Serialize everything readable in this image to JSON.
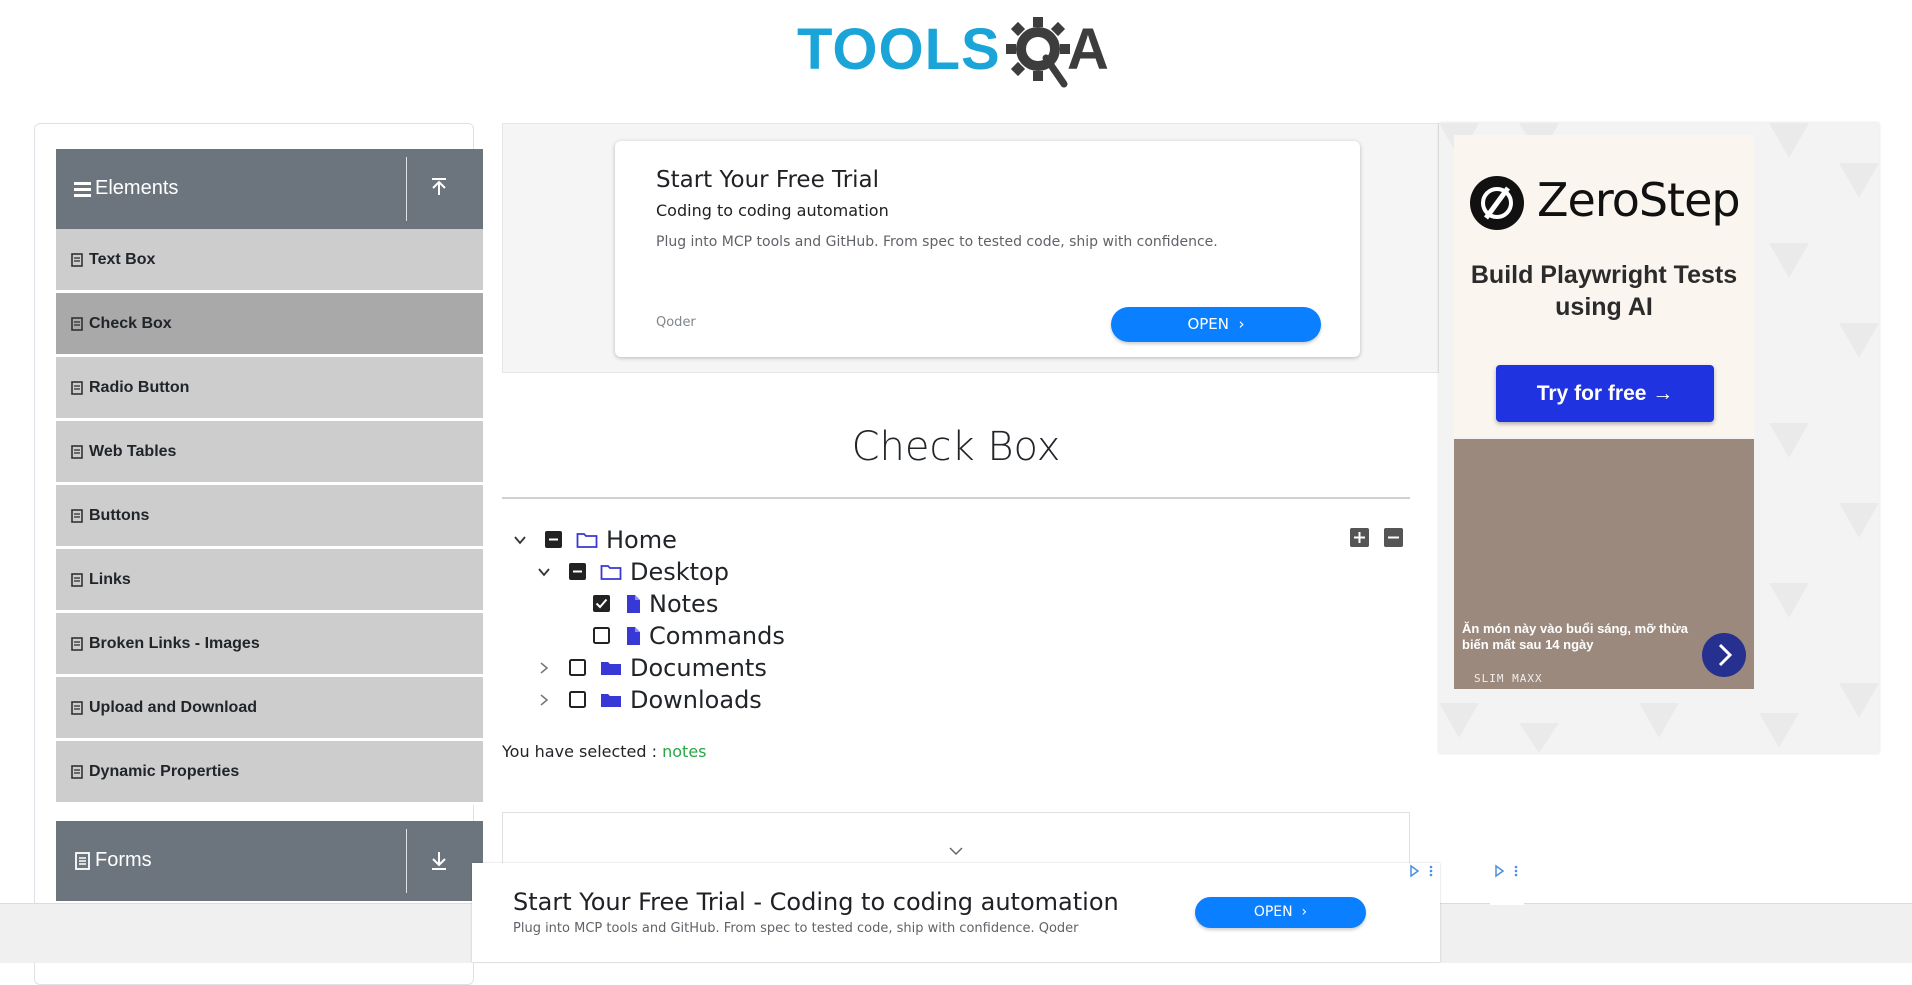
{
  "header": {
    "logo_tools": "TOOLS",
    "logo_a": "A"
  },
  "sidebar": {
    "group_elements": "Elements",
    "items": [
      {
        "label": "Text Box",
        "active": false
      },
      {
        "label": "Check Box",
        "active": true
      },
      {
        "label": "Radio Button",
        "active": false
      },
      {
        "label": "Web Tables",
        "active": false
      },
      {
        "label": "Buttons",
        "active": false
      },
      {
        "label": "Links",
        "active": false
      },
      {
        "label": "Broken Links - Images",
        "active": false
      },
      {
        "label": "Upload and Download",
        "active": false
      },
      {
        "label": "Dynamic Properties",
        "active": false
      }
    ],
    "group_forms": "Forms"
  },
  "top_ad": {
    "title": "Start Your Free Trial",
    "subtitle": "Coding to coding automation",
    "description": "Plug into MCP tools and GitHub. From spec to tested code, ship with confidence.",
    "brand": "Qoder",
    "button": "OPEN"
  },
  "main": {
    "title": "Check Box",
    "tree": [
      {
        "label": "Home",
        "state": "partial",
        "expanded": true,
        "type": "folder"
      },
      {
        "label": "Desktop",
        "state": "partial",
        "expanded": true,
        "type": "folder"
      },
      {
        "label": "Notes",
        "state": "checked",
        "type": "file"
      },
      {
        "label": "Commands",
        "state": "unchecked",
        "type": "file"
      },
      {
        "label": "Documents",
        "state": "unchecked",
        "expanded": false,
        "type": "folder"
      },
      {
        "label": "Downloads",
        "state": "unchecked",
        "expanded": false,
        "type": "folder"
      }
    ],
    "result_label": "You have selected :",
    "result_value": "notes"
  },
  "right_ad": {
    "brand": "ZeroStep",
    "headline": "Build Playwright Tests using AI",
    "button": "Try for free →",
    "promo_text": "Ăn món này vào buổi sáng, mỡ thừa biến mất sau 14 ngày",
    "promo_brand": "SLIM MAXX"
  },
  "bottom_ad": {
    "title": "Start Your Free Trial - Coding to coding automation",
    "description": "Plug into MCP tools and GitHub. From spec to tested code, ship with confidence. Qoder",
    "button": "OPEN"
  },
  "colors": {
    "logo_blue": "#1ba4d8",
    "sidebar_header": "#6c757d",
    "menu_item": "#cdcdcd",
    "menu_active": "#a9a9a9",
    "folder_icon": "#3838d6",
    "ad_button": "#0a7fff",
    "zerostep_button": "#1f33e0",
    "selected_text": "#28a745"
  },
  "icons": {
    "hamburger": "hamburger-icon",
    "upload": "upload-arrow-icon",
    "download": "download-arrow-icon",
    "menu_item": "document-icon",
    "chevron_down": "chevron-down-icon",
    "chevron_right": "chevron-right-icon",
    "folder_open": "folder-open-icon",
    "folder_closed": "folder-icon",
    "file": "file-icon",
    "expand_all": "plus-square-icon",
    "collapse_all": "minus-square-icon"
  }
}
